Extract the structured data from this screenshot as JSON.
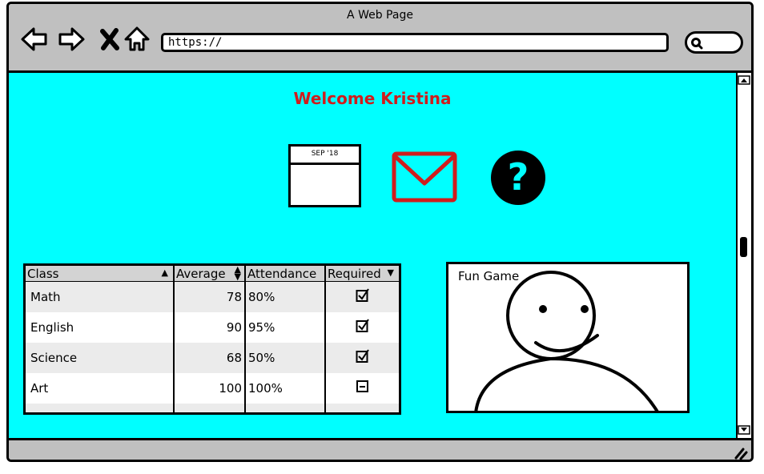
{
  "window": {
    "title": "A Web Page"
  },
  "nav": {
    "back_icon": "arrow-left-icon",
    "forward_icon": "arrow-right-icon",
    "stop_icon": "close-icon",
    "home_icon": "home-icon",
    "search_icon": "search-icon"
  },
  "address_bar": {
    "value": "https://"
  },
  "main": {
    "welcome": "Welcome Kristina",
    "calendar": {
      "label": "SEP '18"
    },
    "accent_color": "#d01c1c",
    "background_color": "#00ffff"
  },
  "grades_table": {
    "columns": [
      "Class",
      "Average",
      "Attendance",
      "Required"
    ],
    "rows": [
      {
        "class": "Math",
        "average": "78",
        "attendance": "80%",
        "required": "checked"
      },
      {
        "class": "English",
        "average": "90",
        "attendance": "95%",
        "required": "checked"
      },
      {
        "class": "Science",
        "average": "68",
        "attendance": "50%",
        "required": "checked"
      },
      {
        "class": "Art",
        "average": "100",
        "attendance": "100%",
        "required": "indeterminate"
      }
    ]
  },
  "game_panel": {
    "label": "Fun Game"
  }
}
